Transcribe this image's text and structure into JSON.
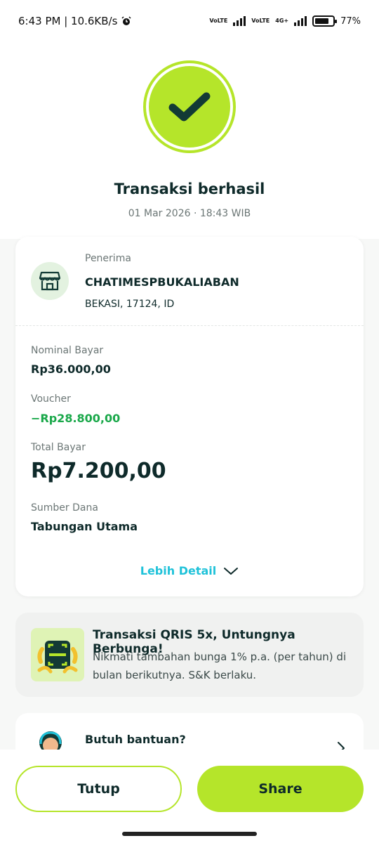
{
  "status_bar": {
    "time_speed": "6:43 PM | 10.6KB/s",
    "sim1": "VoLTE",
    "sim2": "VoLTE",
    "network2": "4G+",
    "battery": "77%"
  },
  "header": {
    "title": "Transaksi berhasil",
    "datetime": "01 Mar 2026 · 18:43 WIB"
  },
  "recipient": {
    "label": "Penerima",
    "name": "CHATIMESPBUKALIABAN",
    "location": "BEKASI, 17124, ID",
    "icon": "store-icon"
  },
  "details": {
    "nominal_label": "Nominal Bayar",
    "nominal_value": "Rp36.000,00",
    "voucher_label": "Voucher",
    "voucher_value": "−Rp28.800,00",
    "total_label": "Total Bayar",
    "total_value": "Rp7.200,00",
    "source_label": "Sumber Dana",
    "source_value": "Tabungan Utama",
    "more_label": "Lebih Detail"
  },
  "promo": {
    "title": "Transaksi QRIS 5x, Untungnya Berbunga!",
    "description": "Nikmati tambahan bunga 1% p.a. (per tahun) di bulan berikutnya. S&K berlaku."
  },
  "help": {
    "title": "Butuh bantuan?"
  },
  "actions": {
    "close_label": "Tutup",
    "share_label": "Share"
  },
  "colors": {
    "accent": "#b5e52a",
    "link": "#1fc2d9",
    "voucher": "#1aa84a",
    "text": "#0e2a2a"
  }
}
